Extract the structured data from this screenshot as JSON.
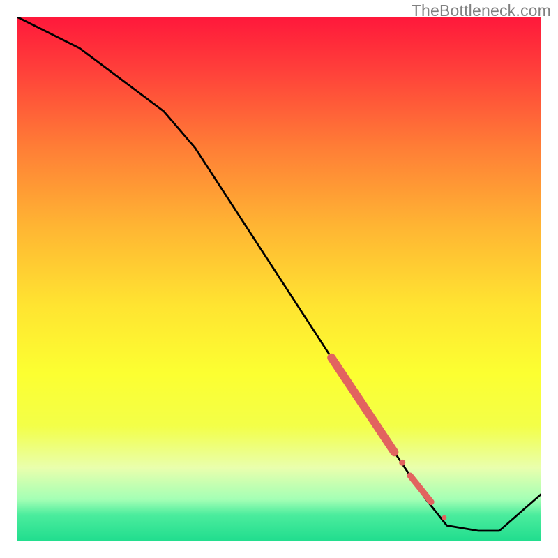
{
  "attribution": "TheBottleneck.com",
  "chart_data": {
    "type": "line",
    "title": "",
    "xlabel": "",
    "ylabel": "",
    "xlim": [
      0,
      100
    ],
    "ylim": [
      0,
      100
    ],
    "background": "performance-gradient",
    "gradient_stops": [
      {
        "pos": 0.0,
        "color": "#ff183b"
      },
      {
        "pos": 0.1,
        "color": "#ff3f3a"
      },
      {
        "pos": 0.25,
        "color": "#ff7e36"
      },
      {
        "pos": 0.4,
        "color": "#ffb533"
      },
      {
        "pos": 0.55,
        "color": "#ffe431"
      },
      {
        "pos": 0.68,
        "color": "#fcff31"
      },
      {
        "pos": 0.78,
        "color": "#f3ff48"
      },
      {
        "pos": 0.86,
        "color": "#e9ffad"
      },
      {
        "pos": 0.92,
        "color": "#a4ffb5"
      },
      {
        "pos": 0.95,
        "color": "#4bec9d"
      },
      {
        "pos": 1.0,
        "color": "#20dd8e"
      }
    ],
    "series": [
      {
        "name": "bottleneck-curve",
        "x": [
          0,
          12,
          28,
          34,
          60,
          70,
          78,
          82,
          88,
          92,
          100
        ],
        "y": [
          100,
          94,
          82,
          75,
          35,
          20,
          8,
          3,
          2,
          2,
          9
        ]
      }
    ],
    "highlight_segments": [
      {
        "name": "segment-thick",
        "x": [
          60,
          72
        ],
        "y": [
          35,
          17
        ],
        "width": 12,
        "color": "#e2645f"
      },
      {
        "name": "segment-dot-1",
        "x": [
          73.5
        ],
        "y": [
          15
        ],
        "width": 9,
        "color": "#e2645f"
      },
      {
        "name": "segment-mid",
        "x": [
          75,
          79
        ],
        "y": [
          12.5,
          7.5
        ],
        "width": 9,
        "color": "#e2645f"
      },
      {
        "name": "segment-dot-2",
        "x": [
          81.5
        ],
        "y": [
          4.5
        ],
        "width": 7,
        "color": "#e2645f"
      }
    ]
  }
}
